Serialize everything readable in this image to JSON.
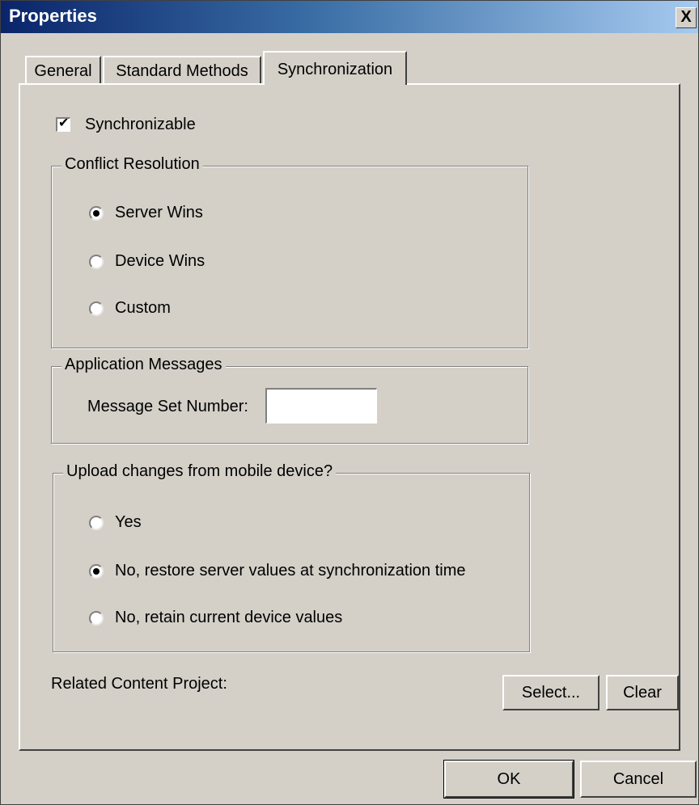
{
  "window": {
    "title": "Properties",
    "close_glyph": "X"
  },
  "tabs": [
    {
      "label": "General",
      "active": false
    },
    {
      "label": "Standard Methods",
      "active": false
    },
    {
      "label": "Synchronization",
      "active": true
    }
  ],
  "sync": {
    "synchronizable_label": "Synchronizable",
    "synchronizable_checked": true,
    "check_glyph": "✔"
  },
  "conflict_resolution": {
    "title": "Conflict Resolution",
    "options": [
      {
        "label": "Server Wins",
        "selected": true
      },
      {
        "label": "Device Wins",
        "selected": false
      },
      {
        "label": "Custom",
        "selected": false
      }
    ]
  },
  "application_messages": {
    "title": "Application Messages",
    "message_set_label": "Message Set Number:",
    "message_set_value": ""
  },
  "upload_changes": {
    "title": "Upload changes from mobile device?",
    "options": [
      {
        "label": "Yes",
        "selected": false
      },
      {
        "label": "No, restore server values at synchronization time",
        "selected": true
      },
      {
        "label": "No, retain current device values",
        "selected": false
      }
    ]
  },
  "related_content": {
    "label": "Related Content Project:",
    "select_label": "Select...",
    "clear_label": "Clear"
  },
  "footer": {
    "ok_label": "OK",
    "cancel_label": "Cancel"
  }
}
